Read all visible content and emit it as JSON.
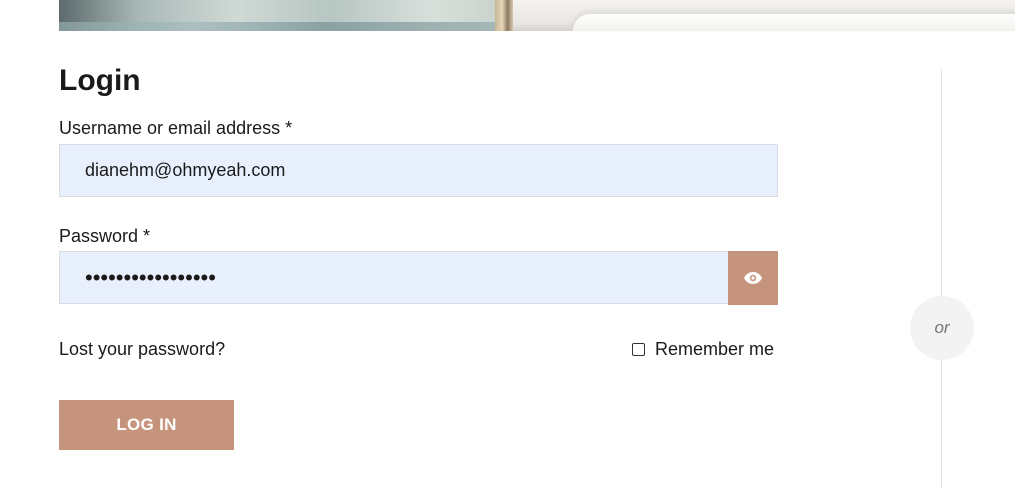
{
  "colors": {
    "accent": "#c6937c",
    "input_bg": "#e8f0fe",
    "divider": "#e4e4e4"
  },
  "login": {
    "title": "Login",
    "username_label": "Username or email address *",
    "username_value": "dianehm@ohmyeah.com",
    "password_label": "Password *",
    "password_masked": "•••••••••••••••••",
    "show_password_icon": "eye-icon",
    "lost_password": "Lost your password?",
    "remember_me": "Remember me",
    "remember_checked": false,
    "submit_label": "LOG IN"
  },
  "separator": {
    "label": "or"
  }
}
